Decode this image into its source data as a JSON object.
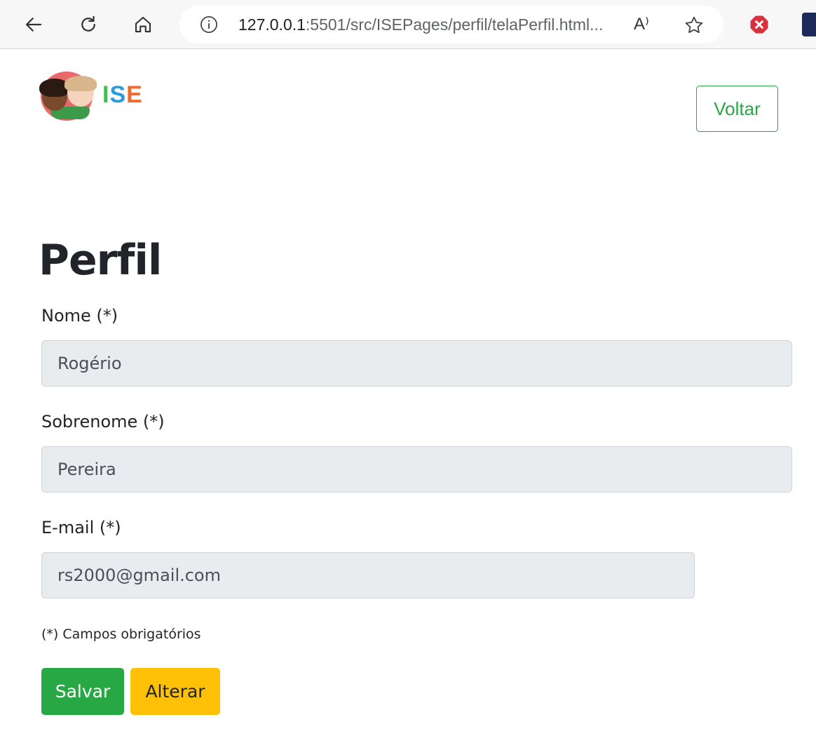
{
  "browser": {
    "url_host": "127.0.0.1",
    "url_rest": ":5501/src/ISEPages/perfil/telaPerfil.html...",
    "read_aloud_glyph": "A⁾"
  },
  "logo": {
    "text_i": "I",
    "text_s": "S",
    "text_e": "E"
  },
  "header": {
    "back_button_label": "Voltar"
  },
  "page": {
    "title": "Perfil"
  },
  "form": {
    "nome": {
      "label": "Nome (*)",
      "value": "Rogério"
    },
    "sobrenome": {
      "label": "Sobrenome (*)",
      "value": "Pereira"
    },
    "email": {
      "label": "E-mail (*)",
      "value": "rs2000@gmail.com"
    },
    "required_note": "(*) Campos obrigatórios",
    "save_label": "Salvar",
    "edit_label": "Alterar"
  },
  "colors": {
    "success": "#28a745",
    "warning": "#ffc107",
    "input_disabled_bg": "#e9ecef"
  },
  "icons": [
    "back-arrow-icon",
    "reload-icon",
    "home-icon",
    "info-icon",
    "read-aloud-icon",
    "star-icon",
    "close-icon"
  ]
}
